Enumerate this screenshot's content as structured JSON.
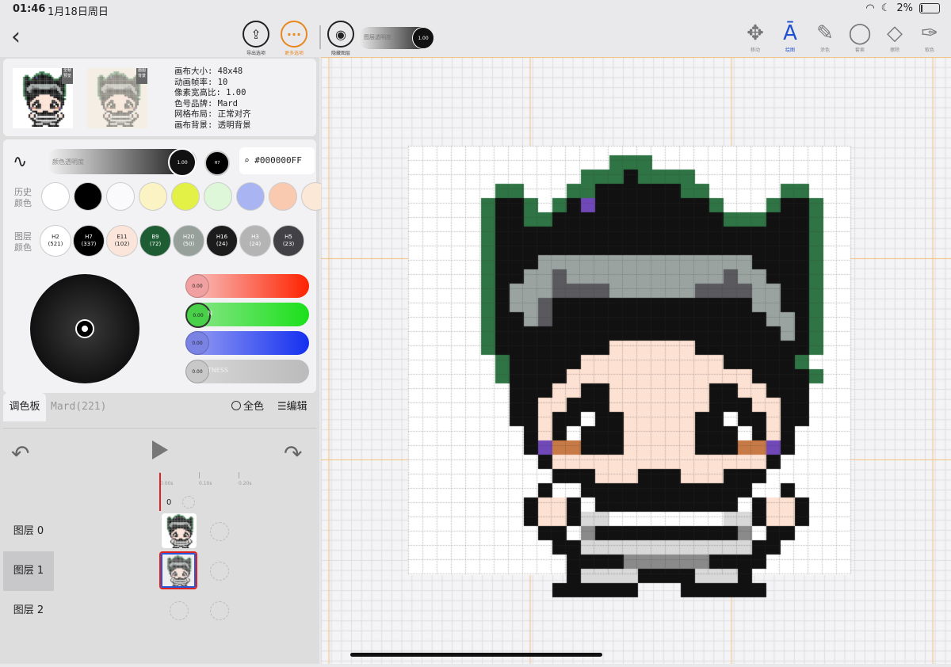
{
  "status": {
    "time": "01:46",
    "date": "1月18日周日",
    "battery": "2%"
  },
  "toolbar": {
    "export_label": "导出选项",
    "more_label": "更多选项",
    "hide_layer_label": "隐藏图层",
    "layer_opacity_label": "图层透明度",
    "layer_opacity_value": "1.00",
    "tools": [
      {
        "name": "move",
        "icon": "move-icon",
        "label": "移动",
        "active": false
      },
      {
        "name": "draw",
        "icon": "pen-icon",
        "label": "绘图",
        "active": true
      },
      {
        "name": "fill",
        "icon": "brush-icon",
        "label": "涂色",
        "active": false
      },
      {
        "name": "lasso",
        "icon": "lasso-icon",
        "label": "套索",
        "active": false
      },
      {
        "name": "erase",
        "icon": "eraser-icon",
        "label": "擦除",
        "active": false
      },
      {
        "name": "pick",
        "icon": "eyedropper-icon",
        "label": "取色",
        "active": false
      }
    ]
  },
  "preview": {
    "tag1": "全帧预览",
    "tag2": "画图背景",
    "info": [
      "画布大小: 48x48",
      "动画帧率: 10",
      "像素宽高比: 1.00",
      "色号品牌: Mard",
      "网格布局: 正常对齐",
      "画布背景: 透明背景"
    ]
  },
  "color": {
    "opacity_label": "颜色透明度",
    "opacity_value": "1.00",
    "current_code": "H7",
    "hex": "#000000FF"
  },
  "history": {
    "label": "历史颜色",
    "colors": [
      "#ffffff",
      "#000000",
      "#fafafc",
      "#fbf3c4",
      "#e3f046",
      "#ddf7d8",
      "#a9b4f2",
      "#f9c9b0",
      "#fbe8d6"
    ]
  },
  "layer_colors": {
    "label": "图层颜色",
    "items": [
      {
        "code": "H2",
        "count": "(521)",
        "hex": "#ffffff",
        "text": "#222222"
      },
      {
        "code": "H7",
        "count": "(337)",
        "hex": "#000000",
        "text": "#ffffff"
      },
      {
        "code": "E11",
        "count": "(102)",
        "hex": "#fbe4da",
        "text": "#222222"
      },
      {
        "code": "B9",
        "count": "(72)",
        "hex": "#1e5d34",
        "text": "#ffffff"
      },
      {
        "code": "H20",
        "count": "(50)",
        "hex": "#98a09c",
        "text": "#ffffff"
      },
      {
        "code": "H16",
        "count": "(24)",
        "hex": "#1c1c1c",
        "text": "#ffffff"
      },
      {
        "code": "H3",
        "count": "(24)",
        "hex": "#b4b4b4",
        "text": "#ffffff"
      },
      {
        "code": "H5",
        "count": "(23)",
        "hex": "#414146",
        "text": "#ffffff"
      }
    ]
  },
  "sliders": [
    {
      "name": "red",
      "value": "0.00",
      "label": ""
    },
    {
      "name": "green",
      "value": "0.00",
      "label": "N"
    },
    {
      "name": "blue",
      "value": "0.00",
      "label": ""
    },
    {
      "name": "brightness",
      "value": "0.00",
      "label": "TNESS"
    }
  ],
  "palette": {
    "tab": "调色板",
    "brand": "Mard(221)",
    "all": "全色",
    "edit": "编辑"
  },
  "timeline": {
    "ticks": [
      "0.00s",
      "0.10s",
      "0.20s"
    ],
    "frame": "0"
  },
  "layers": [
    "图层 0",
    "图层 1",
    "图层 2"
  ],
  "pixel_colors": {
    "g": "#2f7444",
    "k": "#111111",
    "w": "#ffffff",
    "s": "#9aa3a0",
    "d": "#5a5a5e",
    "f": "#fde1d3",
    "b": "#c77a46",
    "p": "#7048b8",
    "l": "#d8d8d8",
    "m": "#8a8a8a"
  }
}
